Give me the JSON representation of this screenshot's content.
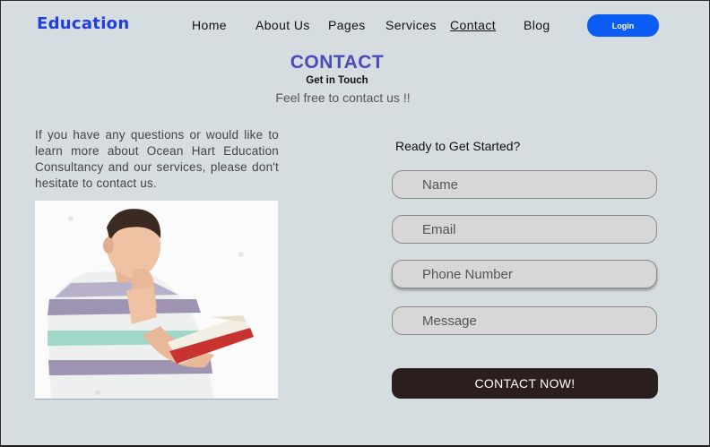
{
  "header": {
    "brand": "Education",
    "nav": [
      "Home",
      "About Us",
      "Pages",
      "Services",
      "Contact",
      "Blog"
    ],
    "active_nav": "Contact",
    "login_label": "Login"
  },
  "hero": {
    "title": "CONTACT",
    "subtitle": "Get in Touch",
    "lead": "Feel free to contact us !!"
  },
  "intro": {
    "text": "If you have any questions or would like to learn more about Ocean Hart Education Consultancy and our services, please don't hesitate to contact us."
  },
  "form": {
    "heading": "Ready to Get Started?",
    "name_placeholder": "Name",
    "email_placeholder": "Email",
    "phone_placeholder": "Phone Number",
    "message_placeholder": "Message",
    "submit_label": "CONTACT NOW!"
  },
  "colors": {
    "background": "#d6dde1",
    "brand": "#1f3ee0",
    "title": "#4a4ab8",
    "login_button": "#0a5cf5",
    "submit_button": "#2b1e1e"
  }
}
